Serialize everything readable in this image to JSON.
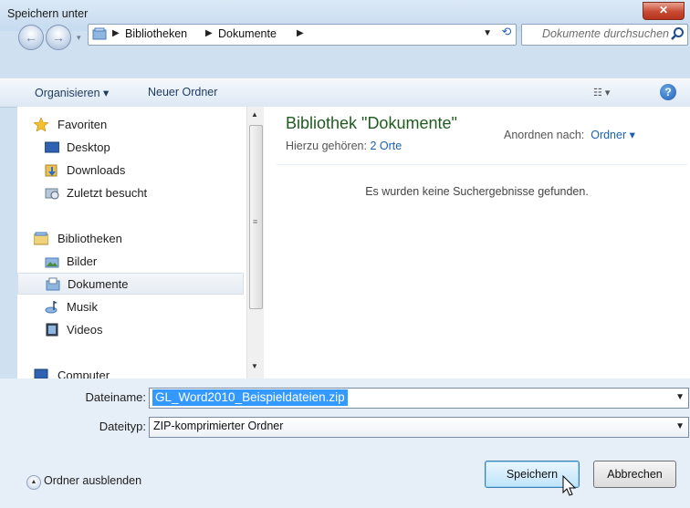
{
  "window": {
    "title": "Speichern unter",
    "close_glyph": "✕"
  },
  "address": {
    "crumbs": [
      "Bibliotheken",
      "Dokumente"
    ],
    "search_placeholder": "Dokumente durchsuchen"
  },
  "toolbar": {
    "organize": "Organisieren ▾",
    "new_folder": "Neuer Ordner"
  },
  "navigation": {
    "items": [
      {
        "label": "Favoriten",
        "icon": "star-icon"
      },
      {
        "label": "Desktop",
        "icon": "desktop-icon"
      },
      {
        "label": "Downloads",
        "icon": "downloads-icon"
      },
      {
        "label": "Zuletzt besucht",
        "icon": "recent-places-icon"
      },
      {
        "label": "Bibliotheken",
        "icon": "libraries-icon"
      },
      {
        "label": "Bilder",
        "icon": "pictures-icon"
      },
      {
        "label": "Dokumente",
        "icon": "documents-icon",
        "selected": true
      },
      {
        "label": "Musik",
        "icon": "music-icon"
      },
      {
        "label": "Videos",
        "icon": "videos-icon"
      },
      {
        "label": "Computer",
        "icon": "computer-icon"
      }
    ]
  },
  "content": {
    "title": "Bibliothek \"Dokumente\"",
    "subtitle_prefix": "Hierzu gehören:",
    "subtitle_link": "2 Orte",
    "arrange_label": "Anordnen nach:",
    "arrange_value": "Ordner ▾",
    "empty_message": "Es wurden keine Suchergebnisse gefunden."
  },
  "form": {
    "filename_label": "Dateiname:",
    "filename_value": "GL_Word2010_Beispieldateien.zip",
    "filetype_label": "Dateityp:",
    "filetype_value": "ZIP-komprimierter Ordner"
  },
  "footer": {
    "hide_folders": "Ordner ausblenden",
    "save": "Speichern",
    "cancel": "Abbrechen"
  },
  "colors": {
    "title_green": "#1f5b1f",
    "link_blue": "#1a5fb4",
    "selection": "#3399ff"
  }
}
